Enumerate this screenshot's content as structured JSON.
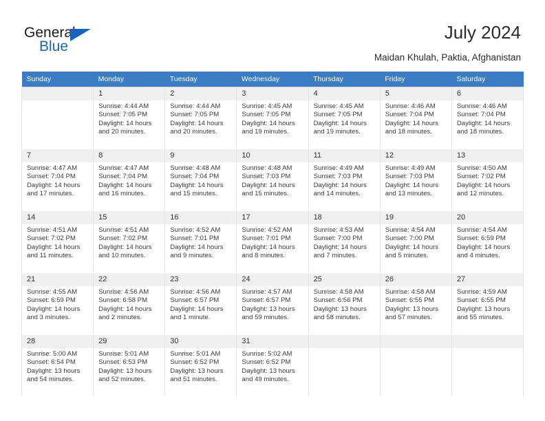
{
  "brand": {
    "name_part1": "General",
    "name_part2": "Blue",
    "accent_color": "#1565c0"
  },
  "header": {
    "title": "July 2024",
    "subtitle": "Maidan Khulah, Paktia, Afghanistan"
  },
  "calendar": {
    "header_bg": "#3b7dc4",
    "weekdays": [
      "Sunday",
      "Monday",
      "Tuesday",
      "Wednesday",
      "Thursday",
      "Friday",
      "Saturday"
    ],
    "labels": {
      "sunrise": "Sunrise:",
      "sunset": "Sunset:",
      "daylight": "Daylight:"
    },
    "weeks": [
      [
        {
          "day": "",
          "sunrise": "",
          "sunset": "",
          "daylight": "",
          "empty": true
        },
        {
          "day": "1",
          "sunrise": "Sunrise: 4:44 AM",
          "sunset": "Sunset: 7:05 PM",
          "daylight": "Daylight: 14 hours and 20 minutes."
        },
        {
          "day": "2",
          "sunrise": "Sunrise: 4:44 AM",
          "sunset": "Sunset: 7:05 PM",
          "daylight": "Daylight: 14 hours and 20 minutes."
        },
        {
          "day": "3",
          "sunrise": "Sunrise: 4:45 AM",
          "sunset": "Sunset: 7:05 PM",
          "daylight": "Daylight: 14 hours and 19 minutes."
        },
        {
          "day": "4",
          "sunrise": "Sunrise: 4:45 AM",
          "sunset": "Sunset: 7:05 PM",
          "daylight": "Daylight: 14 hours and 19 minutes."
        },
        {
          "day": "5",
          "sunrise": "Sunrise: 4:46 AM",
          "sunset": "Sunset: 7:04 PM",
          "daylight": "Daylight: 14 hours and 18 minutes."
        },
        {
          "day": "6",
          "sunrise": "Sunrise: 4:46 AM",
          "sunset": "Sunset: 7:04 PM",
          "daylight": "Daylight: 14 hours and 18 minutes."
        }
      ],
      [
        {
          "day": "7",
          "sunrise": "Sunrise: 4:47 AM",
          "sunset": "Sunset: 7:04 PM",
          "daylight": "Daylight: 14 hours and 17 minutes."
        },
        {
          "day": "8",
          "sunrise": "Sunrise: 4:47 AM",
          "sunset": "Sunset: 7:04 PM",
          "daylight": "Daylight: 14 hours and 16 minutes."
        },
        {
          "day": "9",
          "sunrise": "Sunrise: 4:48 AM",
          "sunset": "Sunset: 7:04 PM",
          "daylight": "Daylight: 14 hours and 15 minutes."
        },
        {
          "day": "10",
          "sunrise": "Sunrise: 4:48 AM",
          "sunset": "Sunset: 7:03 PM",
          "daylight": "Daylight: 14 hours and 15 minutes."
        },
        {
          "day": "11",
          "sunrise": "Sunrise: 4:49 AM",
          "sunset": "Sunset: 7:03 PM",
          "daylight": "Daylight: 14 hours and 14 minutes."
        },
        {
          "day": "12",
          "sunrise": "Sunrise: 4:49 AM",
          "sunset": "Sunset: 7:03 PM",
          "daylight": "Daylight: 14 hours and 13 minutes."
        },
        {
          "day": "13",
          "sunrise": "Sunrise: 4:50 AM",
          "sunset": "Sunset: 7:02 PM",
          "daylight": "Daylight: 14 hours and 12 minutes."
        }
      ],
      [
        {
          "day": "14",
          "sunrise": "Sunrise: 4:51 AM",
          "sunset": "Sunset: 7:02 PM",
          "daylight": "Daylight: 14 hours and 11 minutes."
        },
        {
          "day": "15",
          "sunrise": "Sunrise: 4:51 AM",
          "sunset": "Sunset: 7:02 PM",
          "daylight": "Daylight: 14 hours and 10 minutes."
        },
        {
          "day": "16",
          "sunrise": "Sunrise: 4:52 AM",
          "sunset": "Sunset: 7:01 PM",
          "daylight": "Daylight: 14 hours and 9 minutes."
        },
        {
          "day": "17",
          "sunrise": "Sunrise: 4:52 AM",
          "sunset": "Sunset: 7:01 PM",
          "daylight": "Daylight: 14 hours and 8 minutes."
        },
        {
          "day": "18",
          "sunrise": "Sunrise: 4:53 AM",
          "sunset": "Sunset: 7:00 PM",
          "daylight": "Daylight: 14 hours and 7 minutes."
        },
        {
          "day": "19",
          "sunrise": "Sunrise: 4:54 AM",
          "sunset": "Sunset: 7:00 PM",
          "daylight": "Daylight: 14 hours and 5 minutes."
        },
        {
          "day": "20",
          "sunrise": "Sunrise: 4:54 AM",
          "sunset": "Sunset: 6:59 PM",
          "daylight": "Daylight: 14 hours and 4 minutes."
        }
      ],
      [
        {
          "day": "21",
          "sunrise": "Sunrise: 4:55 AM",
          "sunset": "Sunset: 6:59 PM",
          "daylight": "Daylight: 14 hours and 3 minutes."
        },
        {
          "day": "22",
          "sunrise": "Sunrise: 4:56 AM",
          "sunset": "Sunset: 6:58 PM",
          "daylight": "Daylight: 14 hours and 2 minutes."
        },
        {
          "day": "23",
          "sunrise": "Sunrise: 4:56 AM",
          "sunset": "Sunset: 6:57 PM",
          "daylight": "Daylight: 14 hours and 1 minute."
        },
        {
          "day": "24",
          "sunrise": "Sunrise: 4:57 AM",
          "sunset": "Sunset: 6:57 PM",
          "daylight": "Daylight: 13 hours and 59 minutes."
        },
        {
          "day": "25",
          "sunrise": "Sunrise: 4:58 AM",
          "sunset": "Sunset: 6:56 PM",
          "daylight": "Daylight: 13 hours and 58 minutes."
        },
        {
          "day": "26",
          "sunrise": "Sunrise: 4:58 AM",
          "sunset": "Sunset: 6:55 PM",
          "daylight": "Daylight: 13 hours and 57 minutes."
        },
        {
          "day": "27",
          "sunrise": "Sunrise: 4:59 AM",
          "sunset": "Sunset: 6:55 PM",
          "daylight": "Daylight: 13 hours and 55 minutes."
        }
      ],
      [
        {
          "day": "28",
          "sunrise": "Sunrise: 5:00 AM",
          "sunset": "Sunset: 6:54 PM",
          "daylight": "Daylight: 13 hours and 54 minutes."
        },
        {
          "day": "29",
          "sunrise": "Sunrise: 5:01 AM",
          "sunset": "Sunset: 6:53 PM",
          "daylight": "Daylight: 13 hours and 52 minutes."
        },
        {
          "day": "30",
          "sunrise": "Sunrise: 5:01 AM",
          "sunset": "Sunset: 6:52 PM",
          "daylight": "Daylight: 13 hours and 51 minutes."
        },
        {
          "day": "31",
          "sunrise": "Sunrise: 5:02 AM",
          "sunset": "Sunset: 6:52 PM",
          "daylight": "Daylight: 13 hours and 49 minutes."
        },
        {
          "day": "",
          "sunrise": "",
          "sunset": "",
          "daylight": "",
          "empty": true
        },
        {
          "day": "",
          "sunrise": "",
          "sunset": "",
          "daylight": "",
          "empty": true
        },
        {
          "day": "",
          "sunrise": "",
          "sunset": "",
          "daylight": "",
          "empty": true
        }
      ]
    ]
  }
}
